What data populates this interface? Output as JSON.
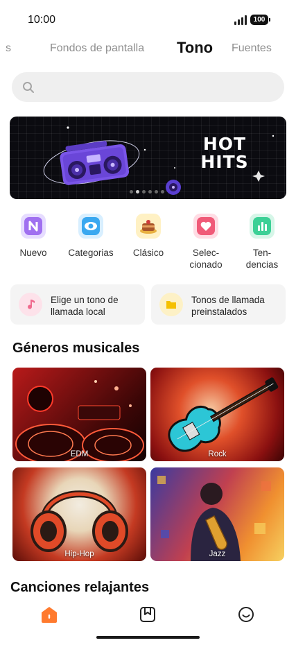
{
  "status_bar": {
    "time": "10:00",
    "battery": "100"
  },
  "top_tabs": [
    {
      "label": "s"
    },
    {
      "label": "Fondos de pantalla"
    },
    {
      "label": "Tono",
      "active": true
    },
    {
      "label": "Fuentes"
    }
  ],
  "search": {
    "placeholder": ""
  },
  "banner": {
    "title_line1": "HOT",
    "title_line2": "HITS",
    "slide_count": 6,
    "active_slide": 2
  },
  "categories": [
    {
      "label": "Nuevo",
      "icon": "new-icon",
      "color": "#a070f0"
    },
    {
      "label": "Categorias",
      "icon": "eye-icon",
      "color": "#3aa8f0"
    },
    {
      "label": "Clásico",
      "icon": "cake-icon",
      "color": "#e8b040"
    },
    {
      "label": "Selec-\ncionado",
      "icon": "heart-icon",
      "color": "#f05a78"
    },
    {
      "label": "Ten-\ndencias",
      "icon": "bar-chart-icon",
      "color": "#3cd096"
    }
  ],
  "quick_actions": [
    {
      "label": "Elige un tono de llamada local",
      "icon": "music-note-icon",
      "color": "#f06a8e"
    },
    {
      "label": "Tonos de llamada preinstalados",
      "icon": "folder-icon",
      "color": "#f5c000"
    }
  ],
  "sections": {
    "genres_title": "Géneros musicales",
    "relaxing_title": "Canciones relajantes"
  },
  "genres": [
    {
      "label": "EDM"
    },
    {
      "label": "Rock"
    },
    {
      "label": "Hip-Hop"
    },
    {
      "label": "Jazz"
    }
  ],
  "bottom_nav": [
    {
      "icon": "home-icon",
      "active": true,
      "color": "#ff7a2e"
    },
    {
      "icon": "bookmark-icon",
      "active": false
    },
    {
      "icon": "smiley-icon",
      "active": false
    }
  ]
}
